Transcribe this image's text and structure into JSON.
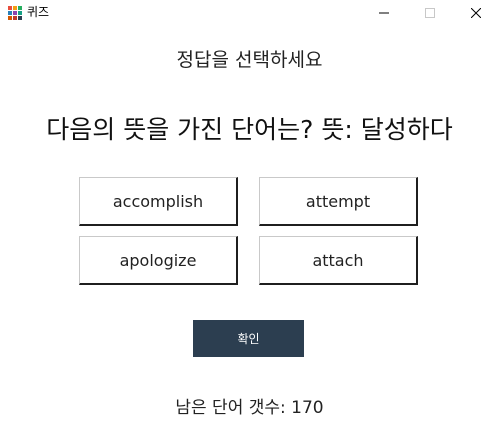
{
  "window": {
    "title": "퀴즈",
    "controls": [
      "minimize",
      "maximize",
      "close"
    ]
  },
  "quiz": {
    "instruction": "정답을 선택하세요",
    "question": "다음의 뜻을 가진 단어는? 뜻: 달성하다",
    "options": [
      "accomplish",
      "attempt",
      "apologize",
      "attach"
    ],
    "confirm_label": "확인",
    "remaining": "남은 단어 갯수: 170"
  },
  "colors": {
    "confirm_bg": "#2c3e50",
    "confirm_text": "#ffffff",
    "background": "#ffffff"
  },
  "icons": {
    "app": "app-grid-icon",
    "minimize": "minimize-icon",
    "maximize": "maximize-icon",
    "close": "close-icon"
  }
}
